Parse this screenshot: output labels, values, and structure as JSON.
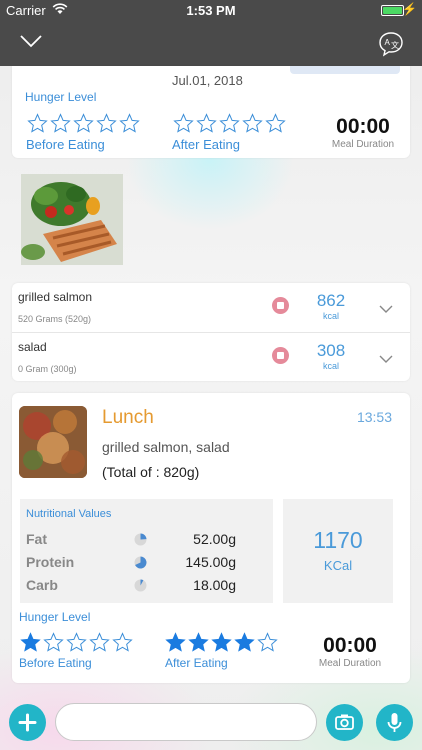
{
  "status_bar": {
    "carrier": "Carrier",
    "time": "1:53 PM",
    "battery_level": 1.0
  },
  "nav": {
    "back_icon": "chevron-down-icon",
    "translate_icon": "translate-icon"
  },
  "previous_meal": {
    "date": "Jul.01, 2018",
    "hunger_label": "Hunger Level",
    "before_label": "Before Eating",
    "before_stars": 0,
    "after_label": "After Eating",
    "after_stars": 0,
    "duration_value": "00:00",
    "duration_label": "Meal Duration"
  },
  "foods": [
    {
      "name": "grilled salmon",
      "qty": "520 Grams (520g)",
      "kcal": "862",
      "unit": "kcal"
    },
    {
      "name": "salad",
      "qty": "0 Gram (300g)",
      "kcal": "308",
      "unit": "kcal"
    }
  ],
  "meal": {
    "title": "Lunch",
    "time": "13:53",
    "items": "grilled salmon, salad",
    "total": "(Total of : 820g)",
    "nutrition_title": "Nutritional Values",
    "nutrients": [
      {
        "name": "Fat",
        "value": "52.00g",
        "fraction": 0.24
      },
      {
        "name": "Protein",
        "value": "145.00g",
        "fraction": 0.68
      },
      {
        "name": "Carb",
        "value": "18.00g",
        "fraction": 0.08
      }
    ],
    "calories": "1170",
    "calories_unit": "KCal",
    "hunger_label": "Hunger Level",
    "before_label": "Before Eating",
    "before_stars": 1,
    "after_label": "After Eating",
    "after_stars": 4,
    "duration_value": "00:00",
    "duration_label": "Meal Duration"
  },
  "composer": {
    "placeholder": "",
    "add_icon": "plus-icon",
    "camera_icon": "camera-icon",
    "mic_icon": "microphone-icon"
  },
  "colors": {
    "accent": "#22b5c8",
    "label_blue": "#3b8ed8",
    "kcal_blue": "#4a9ad9",
    "meal_orange": "#e59a30",
    "star_blue": "#1a7be0"
  }
}
